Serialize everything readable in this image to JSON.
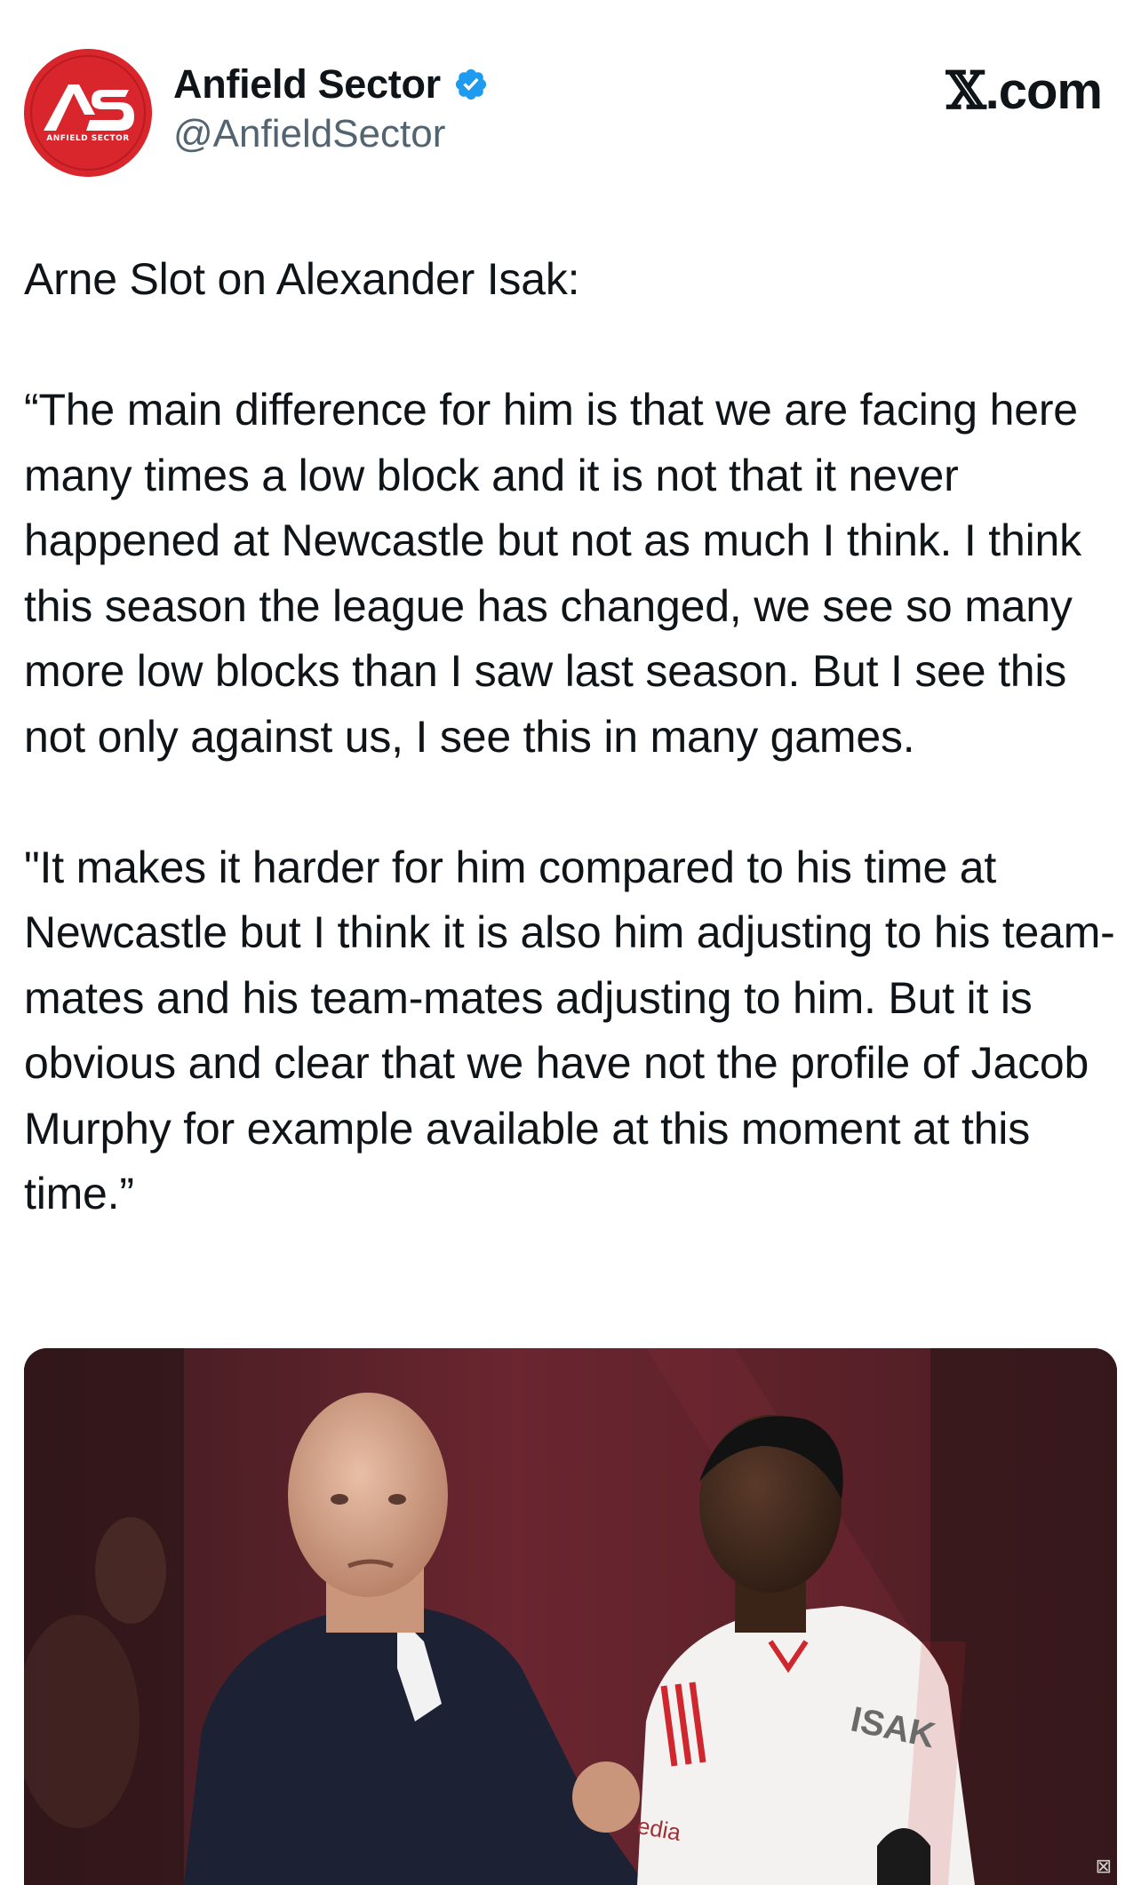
{
  "author": {
    "display_name": "Anfield Sector",
    "handle": "@AnfieldSector",
    "avatar_monogram": "AS",
    "avatar_caption": "ANFIELD SECTOR",
    "avatar_color": "#d9252c",
    "verified_icon": "verified-badge-icon",
    "verified_color": "#1d9bf0"
  },
  "brand": {
    "label_x": "𝕏",
    "label_rest": ".com"
  },
  "tweet": {
    "intro": "Arne Slot on Alexander Isak:",
    "paragraph_1": "“The main difference for him is that we are facing here many times a low block and it is not that it never happened at Newcastle but not as much I think. I think this season the league has changed, we see so many more low blocks than I saw last season. But I see this not only against us, I see this in many games.",
    "paragraph_2": "\"It makes it harder for him compared to his time at Newcastle but I think it is also him adjusting to his team-mates and his team-mates adjusting to him. But it is obvious and clear that we have not the profile of Jacob Murphy for example available at this moment at this time.”"
  },
  "media": {
    "jersey_name": "ISAK",
    "sponsor_text": "edia",
    "background_color": "#5a2128"
  }
}
